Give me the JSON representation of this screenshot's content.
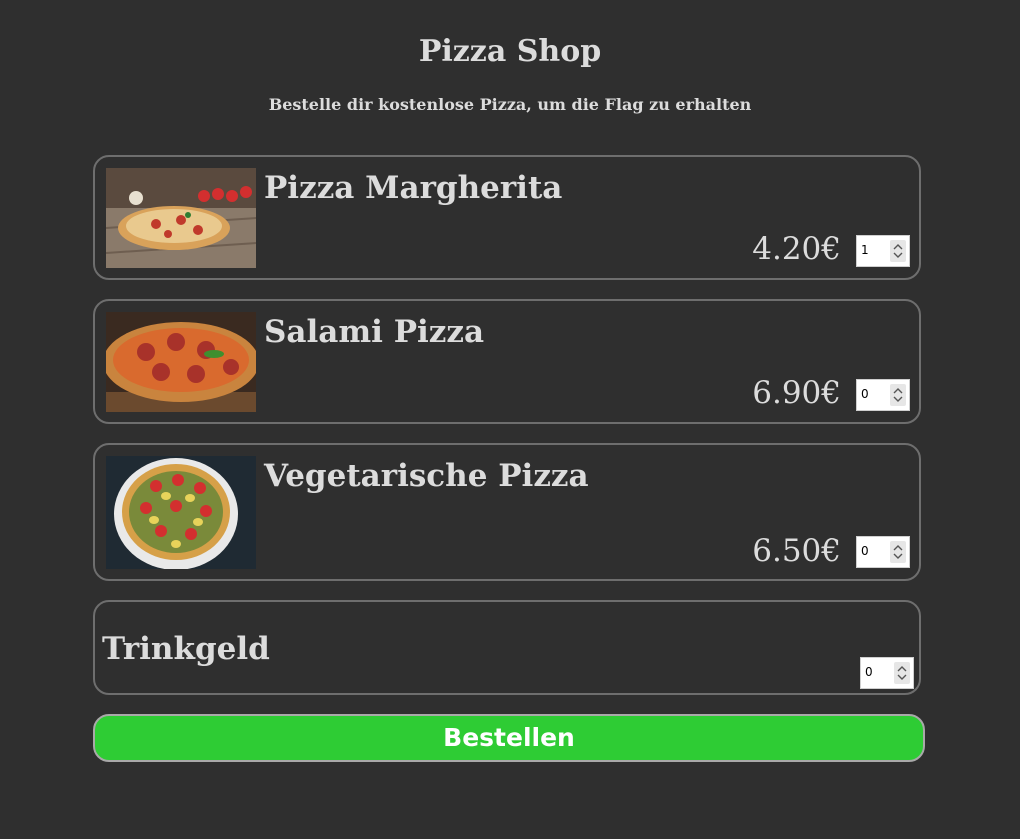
{
  "header": {
    "title": "Pizza Shop",
    "subtitle": "Bestelle dir kostenlose Pizza, um die Flag zu erhalten"
  },
  "products": [
    {
      "name": "Pizza Margherita",
      "price": "4.20€",
      "quantity": "1",
      "image_icon": "pizza-margherita-photo"
    },
    {
      "name": "Salami Pizza",
      "price": "6.90€",
      "quantity": "0",
      "image_icon": "salami-pizza-photo"
    },
    {
      "name": "Vegetarische Pizza",
      "price": "6.50€",
      "quantity": "0",
      "image_icon": "vegetarian-pizza-photo"
    }
  ],
  "tip": {
    "label": "Trinkgeld",
    "value": "0"
  },
  "order_button": {
    "label": "Bestellen"
  },
  "colors": {
    "background": "#2f2f2f",
    "text": "#dcdcdc",
    "card_border": "#6e6e6e",
    "button": "#2ecc34"
  }
}
